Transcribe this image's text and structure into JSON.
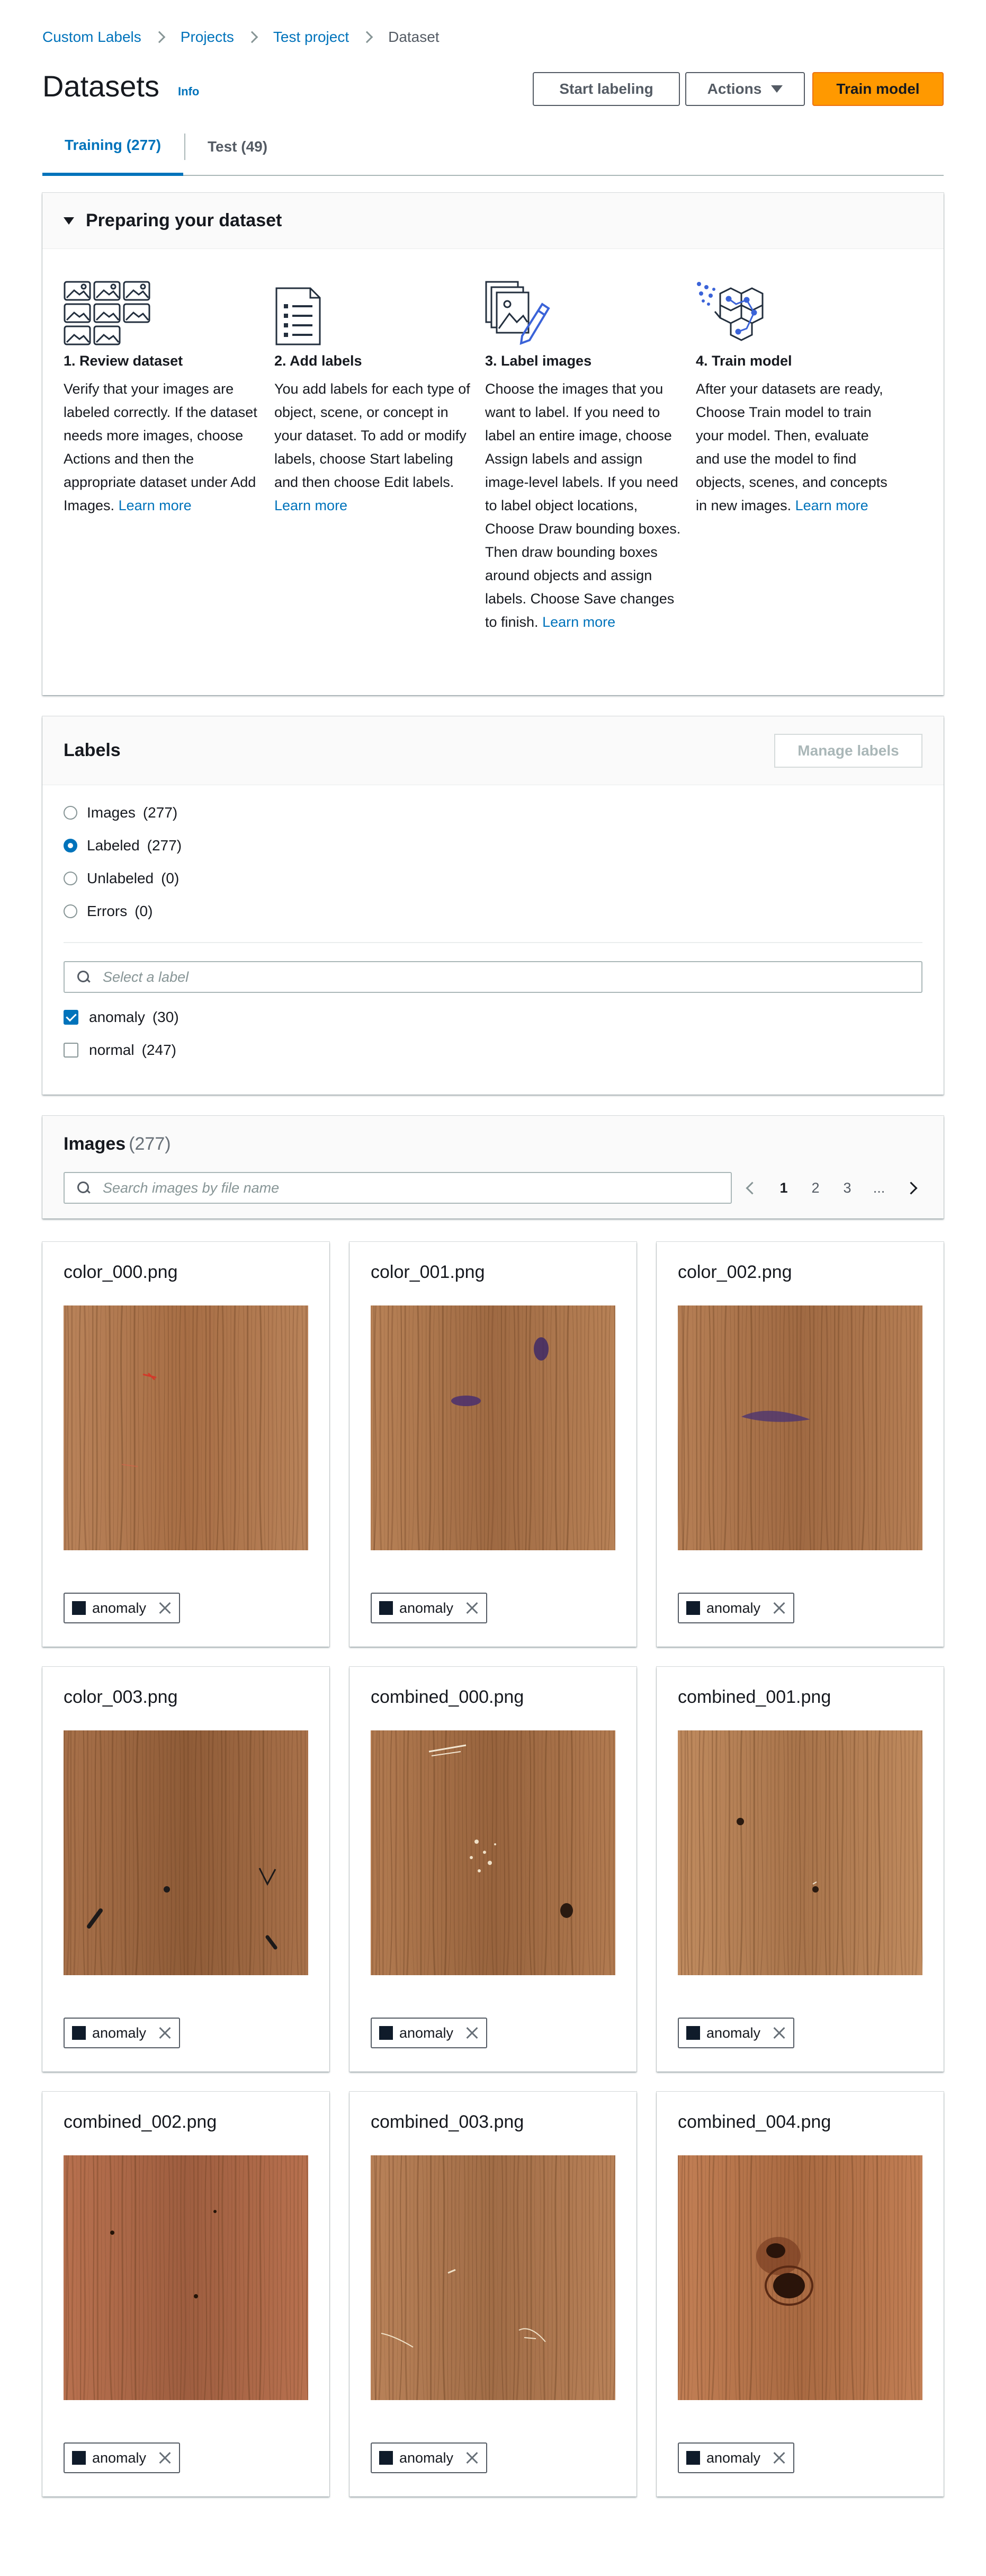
{
  "breadcrumb": {
    "items": [
      "Custom Labels",
      "Projects",
      "Test project"
    ],
    "current": "Dataset"
  },
  "header": {
    "title": "Datasets",
    "info": "Info",
    "start_labeling": "Start labeling",
    "actions": "Actions",
    "train_model": "Train model"
  },
  "tabs": [
    "Training (277)",
    "Test (49)"
  ],
  "prepare": {
    "title": "Preparing your dataset",
    "learn_more": "Learn more",
    "steps": [
      {
        "icon": "images-grid-icon",
        "title": "1. Review dataset",
        "body": "Verify that your images are labeled correctly. If the dataset needs more images, choose Actions and then the appropriate dataset under Add Images."
      },
      {
        "icon": "list-document-icon",
        "title": "2. Add labels",
        "body": "You add labels for each type of object, scene, or concept in your dataset. To add or modify labels, choose Start labeling and then choose Edit labels."
      },
      {
        "icon": "label-images-icon",
        "title": "3. Label images",
        "body": "Choose the images that you want to label. If you need to label an entire image, choose Assign labels and assign image-level labels. If you need to label object locations, Choose Draw bounding boxes. Then draw bounding boxes around objects and assign labels. Choose Save changes to finish."
      },
      {
        "icon": "brain-model-icon",
        "title": "4. Train model",
        "body": "After your datasets are ready, Choose Train model to train your model. Then, evaluate and use the model to find objects, scenes, and concepts in new images."
      }
    ]
  },
  "labels": {
    "title": "Labels",
    "manage": "Manage labels",
    "filters": [
      {
        "label": "Images",
        "count": "(277)",
        "checked": false
      },
      {
        "label": "Labeled",
        "count": "(277)",
        "checked": true
      },
      {
        "label": "Unlabeled",
        "count": "(0)",
        "checked": false
      },
      {
        "label": "Errors",
        "count": "(0)",
        "checked": false
      }
    ],
    "search_placeholder": "Select a label",
    "items": [
      {
        "label": "anomaly",
        "count": "(30)",
        "checked": true
      },
      {
        "label": "normal",
        "count": "(247)",
        "checked": false
      }
    ]
  },
  "images": {
    "title": "Images",
    "count": "(277)",
    "search_placeholder": "Search images by file name",
    "pages": [
      "1",
      "2",
      "3",
      "..."
    ],
    "current_page": "1",
    "cards": [
      {
        "name": "color_000.png",
        "tag": "anomaly",
        "defect": "red-scratch"
      },
      {
        "name": "color_001.png",
        "tag": "anomaly",
        "defect": "purple-stain"
      },
      {
        "name": "color_002.png",
        "tag": "anomaly",
        "defect": "purple-smear"
      },
      {
        "name": "color_003.png",
        "tag": "anomaly",
        "defect": "dark-marks"
      },
      {
        "name": "combined_000.png",
        "tag": "anomaly",
        "defect": "scratches-knot"
      },
      {
        "name": "combined_001.png",
        "tag": "anomaly",
        "defect": "holes"
      },
      {
        "name": "combined_002.png",
        "tag": "anomaly",
        "defect": "pinholes"
      },
      {
        "name": "combined_003.png",
        "tag": "anomaly",
        "defect": "fibers"
      },
      {
        "name": "combined_004.png",
        "tag": "anomaly",
        "defect": "knots"
      }
    ]
  },
  "colors": {
    "link": "#0073bb",
    "primary": "#ff9900",
    "label_swatch": "#0f1b2a"
  }
}
